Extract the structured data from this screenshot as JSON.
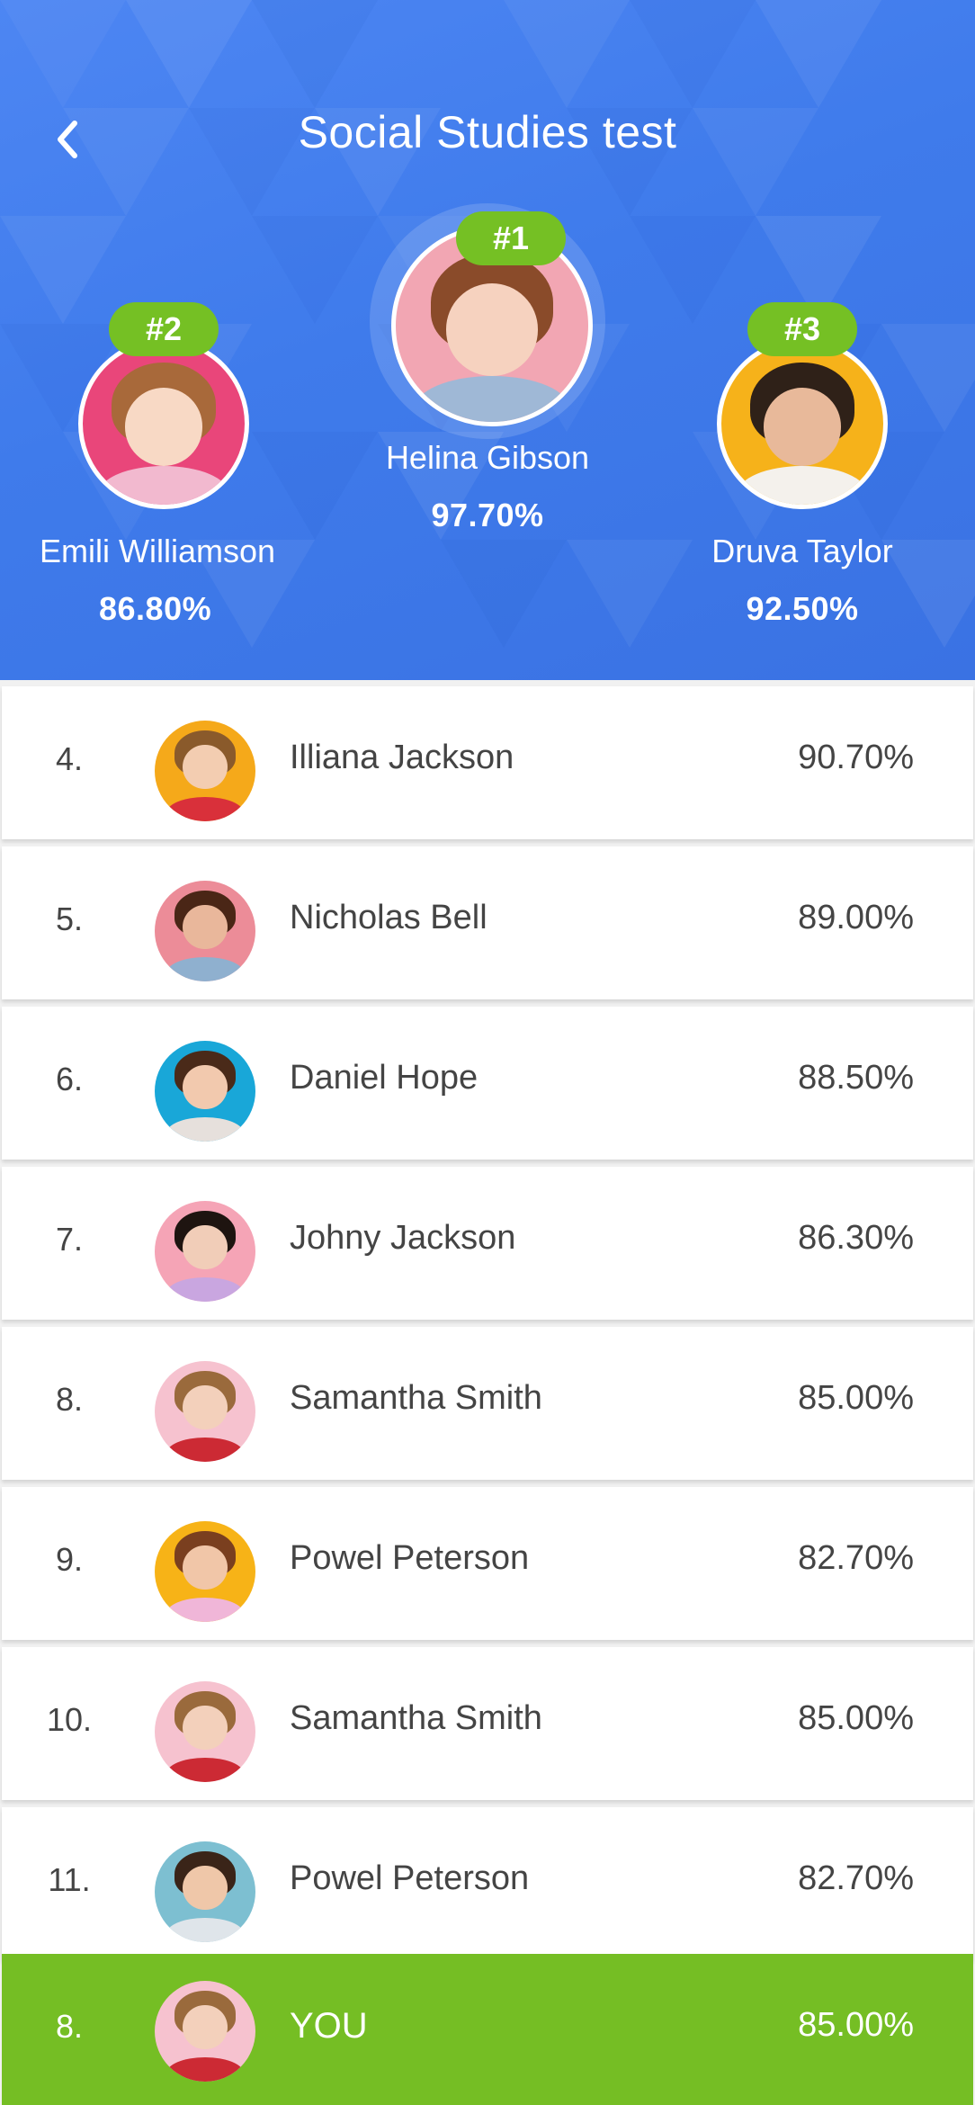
{
  "header": {
    "title": "Social Studies test",
    "back_icon": "chevron-left-icon"
  },
  "podium": [
    {
      "badge": "#1",
      "name": "Helina Gibson",
      "score": "97.70%",
      "bg": "#f2a6b3",
      "hair": "#8a4b2a",
      "skin": "#f6d2bf",
      "shirt": "#9fb8d6"
    },
    {
      "badge": "#2",
      "name": "Emili Williamson",
      "score": "86.80%",
      "bg": "#e9467a",
      "hair": "#a8693a",
      "skin": "#f8d9c5",
      "shirt": "#f2b9cf"
    },
    {
      "badge": "#3",
      "name": "Druva Taylor",
      "score": "92.50%",
      "bg": "#f6b21a",
      "hair": "#2f2118",
      "skin": "#e8b99a",
      "shirt": "#f4f1ec"
    }
  ],
  "rows": [
    {
      "rank": "4.",
      "name": "Illiana Jackson",
      "score": "90.70%",
      "bg": "#f5a91a",
      "hair": "#8a5a2b",
      "skin": "#f3cdb1",
      "shirt": "#d9303a"
    },
    {
      "rank": "5.",
      "name": "Nicholas Bell",
      "score": "89.00%",
      "bg": "#ec8c98",
      "hair": "#4a2616",
      "skin": "#e9b79b",
      "shirt": "#8fb0cf"
    },
    {
      "rank": "6.",
      "name": "Daniel Hope",
      "score": "88.50%",
      "bg": "#19a7d8",
      "hair": "#4a2a19",
      "skin": "#f2c9ae",
      "shirt": "#e6e0dc"
    },
    {
      "rank": "7.",
      "name": "Johny Jackson",
      "score": "86.30%",
      "bg": "#f5a4b6",
      "hair": "#1e1410",
      "skin": "#f1cdb8",
      "shirt": "#c9a6e0"
    },
    {
      "rank": "8.",
      "name": "Samantha Smith",
      "score": "85.00%",
      "bg": "#f6c2cf",
      "hair": "#9a6a3c",
      "skin": "#f3d0bb",
      "shirt": "#cc2a34"
    },
    {
      "rank": "9.",
      "name": "Powel Peterson",
      "score": "82.70%",
      "bg": "#f7b317",
      "hair": "#7a3f1f",
      "skin": "#f1c6a8",
      "shirt": "#f0b6d8"
    },
    {
      "rank": "10.",
      "name": "Samantha Smith",
      "score": "85.00%",
      "bg": "#f6c2cf",
      "hair": "#9a6a3c",
      "skin": "#f3d0bb",
      "shirt": "#cc2a34"
    },
    {
      "rank": "11.",
      "name": "Powel Peterson",
      "score": "82.70%",
      "bg": "#7dbfd1",
      "hair": "#3a2418",
      "skin": "#efc7a9",
      "shirt": "#dfe5ea"
    }
  ],
  "you": {
    "rank": "8.",
    "name": "YOU",
    "score": "85.00%",
    "bg": "#f6c2cf",
    "hair": "#9a6a3c",
    "skin": "#f3d0bb",
    "shirt": "#cc2a34"
  },
  "colors": {
    "header_blue": "#4280ef",
    "accent_green": "#75c024",
    "text": "#444444"
  }
}
